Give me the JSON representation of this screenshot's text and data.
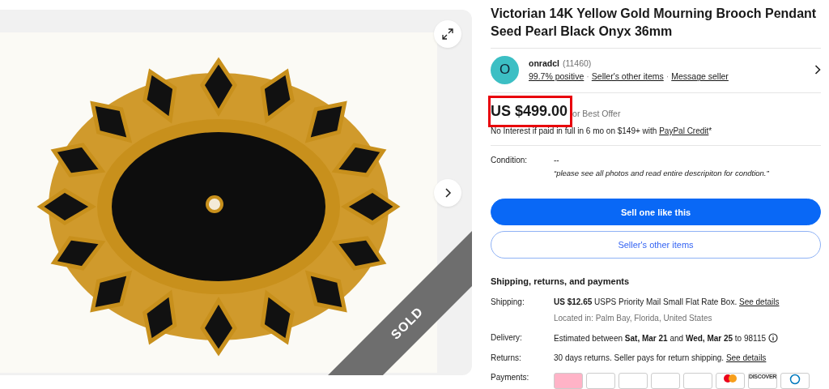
{
  "gallery": {
    "sold_label": "SOLD"
  },
  "title": "Victorian 14K Yellow Gold Mourning Brooch Pendant Seed Pearl Black Onyx 36mm",
  "seller": {
    "initial": "O",
    "name": "onradcl",
    "feedback_count": "(11460)",
    "links": [
      "99.7% positive",
      "Seller's other items",
      "Message seller"
    ],
    "separators": [
      "·",
      "·"
    ]
  },
  "price": {
    "amount": "US $499.00",
    "offer": "or Best Offer",
    "highlighted": true
  },
  "financing": {
    "text": "No Interest if paid in full in 6 mo on $149+ with ",
    "link": "PayPal Credit",
    "mark": "*"
  },
  "condition": {
    "label": "Condition:",
    "value": "--",
    "note": "“please see all photos and read entire descripiton for condtion.”"
  },
  "buttons": [
    {
      "label": "Sell one like this",
      "kind": "primary"
    },
    {
      "label": "Seller's other items",
      "kind": "secondary"
    }
  ],
  "shipping_section": {
    "heading": "Shipping, returns, and payments",
    "rows": [
      {
        "label": "Shipping:",
        "text": "**US $12.65** USPS Priority Mail Small Flat Rate Box. ",
        "link": "See details",
        "sub": "Located in: Palm Bay, Florida, United States"
      },
      {
        "label": "Delivery:",
        "text": "Estimated between **Sat, Mar 21** and **Wed, Mar 25** to 98115",
        "info": true
      },
      {
        "label": "Returns:",
        "text": "30 days returns. Seller pays for return shipping. ",
        "link": "See details"
      },
      {
        "label": "Payments:"
      }
    ],
    "payment_methods": [
      {
        "kind": "pink"
      },
      {
        "kind": "plain"
      },
      {
        "kind": "plain"
      },
      {
        "kind": "plain"
      },
      {
        "kind": "plain"
      },
      {
        "kind": "mastercard"
      },
      {
        "kind": "discover",
        "label": "DISCOVER"
      },
      {
        "kind": "diners"
      }
    ]
  }
}
